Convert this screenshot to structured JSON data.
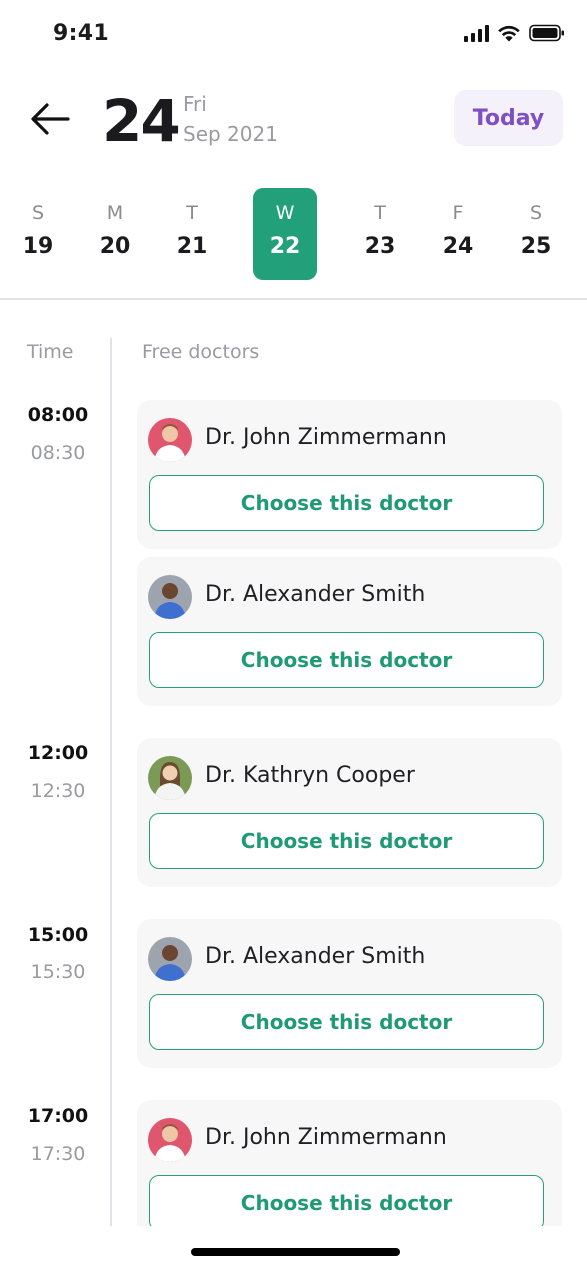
{
  "status_bar": {
    "time": "9:41",
    "icons": [
      "signal-icon",
      "wifi-icon",
      "battery-icon"
    ]
  },
  "header": {
    "back_icon": "arrow-left-icon",
    "day_number": "24",
    "weekday": "Fri",
    "month_year": "Sep 2021",
    "today_label": "Today"
  },
  "week": [
    {
      "letter": "S",
      "num": "19",
      "selected": false
    },
    {
      "letter": "M",
      "num": "20",
      "selected": false
    },
    {
      "letter": "T",
      "num": "21",
      "selected": false
    },
    {
      "letter": "W",
      "num": "22",
      "selected": true
    },
    {
      "letter": "T",
      "num": "23",
      "selected": false
    },
    {
      "letter": "F",
      "num": "24",
      "selected": false
    },
    {
      "letter": "S",
      "num": "25",
      "selected": false
    }
  ],
  "schedule": {
    "time_header": "Time",
    "doctors_header": "Free doctors",
    "slots": [
      {
        "start": "08:00",
        "end": "08:30"
      },
      {
        "start": "12:00",
        "end": "12:30"
      },
      {
        "start": "15:00",
        "end": "15:30"
      },
      {
        "start": "17:00",
        "end": "17:30"
      }
    ],
    "cards": [
      {
        "doctor": "Dr. John Zimmermann",
        "button": "Choose this doctor"
      },
      {
        "doctor": "Dr. Alexander Smith",
        "button": "Choose this doctor"
      },
      {
        "doctor": "Dr. Kathryn Cooper",
        "button": "Choose this doctor"
      },
      {
        "doctor": "Dr. Alexander Smith",
        "button": "Choose this doctor"
      },
      {
        "doctor": "Dr. John Zimmermann",
        "button": "Choose this doctor"
      }
    ]
  },
  "colors": {
    "accent_green": "#21a07a",
    "today_purple": "#7f4fc4",
    "today_bg": "#f4f1fb",
    "card_bg": "#f7f7f8"
  }
}
